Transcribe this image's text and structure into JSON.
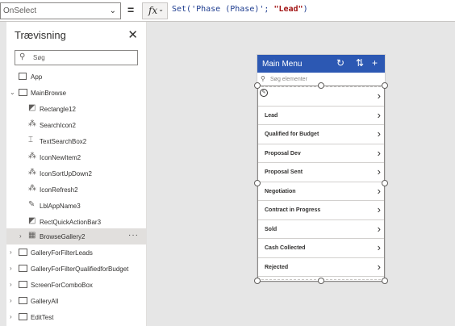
{
  "formula_bar": {
    "property": "OnSelect",
    "equals": "=",
    "fx_label": "fx",
    "formula_prefix": "Set('Phase (Phase)'; ",
    "formula_value": "\"Lead\"",
    "formula_suffix": ")"
  },
  "tree_view": {
    "title": "Trævisning",
    "search_placeholder": "Søg",
    "items": [
      {
        "label": "App",
        "icon": "app-icon"
      },
      {
        "label": "MainBrowse",
        "icon": "screen-icon"
      },
      {
        "label": "Rectangle12",
        "icon": "rectangle-icon"
      },
      {
        "label": "SearchIcon2",
        "icon": "icon-control-icon"
      },
      {
        "label": "TextSearchBox2",
        "icon": "textbox-icon"
      },
      {
        "label": "IconNewItem2",
        "icon": "icon-control-icon"
      },
      {
        "label": "IconSortUpDown2",
        "icon": "icon-control-icon"
      },
      {
        "label": "IconRefresh2",
        "icon": "icon-control-icon"
      },
      {
        "label": "LblAppName3",
        "icon": "label-icon"
      },
      {
        "label": "RectQuickActionBar3",
        "icon": "rectangle-icon"
      },
      {
        "label": "BrowseGallery2",
        "icon": "gallery-icon",
        "selected": true
      },
      {
        "label": "GalleryForFilterLeads",
        "icon": "screen-icon"
      },
      {
        "label": "GalleryForFilterQualifiedforBudget",
        "icon": "screen-icon"
      },
      {
        "label": "ScreenForComboBox",
        "icon": "screen-icon"
      },
      {
        "label": "GalleryAll",
        "icon": "screen-icon"
      },
      {
        "label": "EditTest",
        "icon": "screen-icon"
      }
    ]
  },
  "screen": {
    "title": "Main Menu",
    "search_placeholder": "Søg elementer",
    "gallery_items": [
      "",
      "Lead",
      "Qualified for Budget",
      "Proposal Dev",
      "Proposal Sent",
      "Negotiation",
      "Contract in Progress",
      "Sold",
      "Cash Collected",
      "Rejected"
    ]
  },
  "colors": {
    "header": "#2c58b3",
    "selection": "#e1dfdd"
  }
}
